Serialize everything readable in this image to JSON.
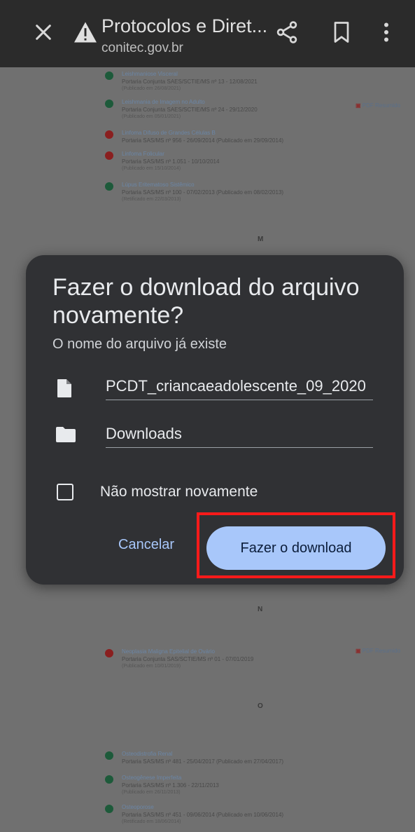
{
  "browser": {
    "title": "Protocolos e Diret...",
    "url": "conitec.gov.br",
    "icons": [
      "close-icon",
      "warning-icon",
      "share-icon",
      "bookmark-icon",
      "more-vert-icon"
    ]
  },
  "page_background": {
    "top_entries": [
      {
        "title": "Leishmaniose Visceral",
        "line2": "Portaria Conjunta SAES/SCTIE/MS nº 13 - 12/08/2021",
        "line3": "(Publicado em 26/08/2021)",
        "status": "green"
      },
      {
        "title": "Leishmania de Imagem no Adulto",
        "line2": "Portaria Conjunta SAES/SCTIE/MS nº 24 - 29/12/2020",
        "line3": "(Publicado em 05/01/2021)",
        "status": "green"
      },
      {
        "title": "Linfoma Difuso de Grandes Células B",
        "line2": "Portaria SAS/MS nº 956 - 26/09/2014 (Publicado em 29/09/2014)",
        "line3": "",
        "status": "red"
      },
      {
        "title": "Linfoma Folicular",
        "line2": "Portaria SAS/MS nº 1.051 - 10/10/2014",
        "line3": "(Publicado em 15/10/2014)",
        "status": "red"
      },
      {
        "title": "Lúpus Eritematoso Sistêmico",
        "line2": "Portaria SAS/MS nº 100 - 07/02/2013 (Publicado em 08/02/2013)",
        "line3": "(Retificado em 22/03/2013)",
        "status": "green"
      }
    ],
    "letter_m": "M",
    "letter_n": "N",
    "letter_o": "O",
    "pdf_tag": "PDF Resumido",
    "n_entries": [
      {
        "title": "Neoplasia Maligna Epitelial de Ovário",
        "line2": "Portaria Conjunta SAS/SCTIE/MS nº 01 - 07/01/2019",
        "line3": "(Publicado em 10/01/2019)",
        "status": "red"
      }
    ],
    "o_entries": [
      {
        "title": "Osteodistrofia Renal",
        "line2": "Portaria SAS/MS nº 481 - 25/04/2017 (Publicado em 27/04/2017)",
        "line3": "",
        "status": "green"
      },
      {
        "title": "Osteogênese Imperfeita",
        "line2": "Portaria SAS/MS nº 1.306 - 22/11/2013",
        "line3": "(Publicado em 26/11/2013)",
        "status": "green"
      },
      {
        "title": "Osteoporose",
        "line2": "Portaria SAS/MS nº 451 - 09/06/2014 (Publicado em 10/06/2014)",
        "line3": "(Retificado em 18/06/2014)",
        "status": "green"
      }
    ]
  },
  "dialog": {
    "title": "Fazer o download do arquivo novamente?",
    "subtitle": "O nome do arquivo já existe",
    "filename": "PCDT_criancaeadolescente_09_2020",
    "folder": "Downloads",
    "checkbox_label": "Não mostrar novamente",
    "checkbox_checked": false,
    "cancel_label": "Cancelar",
    "download_label": "Fazer o download"
  },
  "colors": {
    "dialog_bg": "#303134",
    "primary_button": "#a8c7fa",
    "highlight_box": "#ff1a1a",
    "status_green": "#1d5a3a",
    "status_red": "#8a1f1f"
  }
}
